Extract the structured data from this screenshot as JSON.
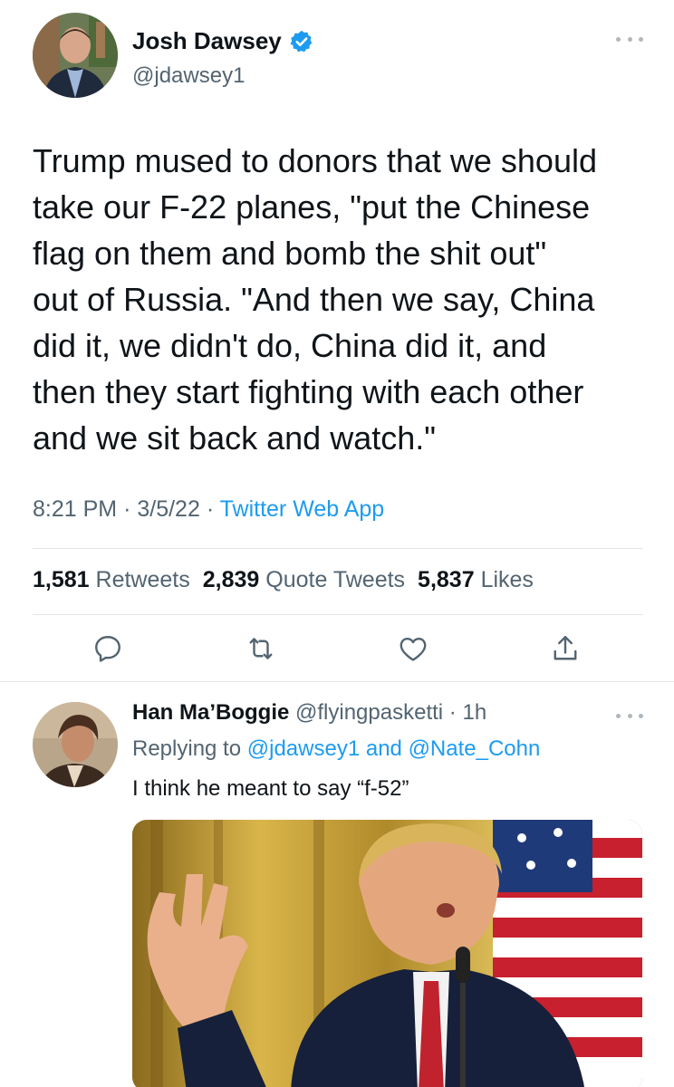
{
  "tweet": {
    "author_name": "Josh Dawsey",
    "author_handle": "@jdawsey1",
    "text": "Trump mused to donors that we should\ntake our F-22 planes, \"put the Chinese\nflag on them and bomb the shit out\"\nout of Russia. \"And then we say, China\ndid it, we didn't do, China did it, and\nthen they start fighting with each other\nand we sit back and watch.\"",
    "time": "8:21 PM",
    "date": "3/5/22",
    "source": "Twitter Web App",
    "retweets_count": "1,581",
    "retweets_label": "Retweets",
    "quotes_count": "2,839",
    "quotes_label": "Quote Tweets",
    "likes_count": "5,837",
    "likes_label": "Likes"
  },
  "reply": {
    "author_name": "Han Ma’Boggie",
    "author_handle": "@flyingpasketti",
    "time": "1h",
    "replying_prefix": "Replying to",
    "mention_1": "@jdawsey1",
    "conjunction": "and",
    "mention_2": "@Nate_Cohn",
    "text": "I think he meant to say “f-52”"
  },
  "icons": {
    "verified": "verified-badge-icon",
    "more": "more-options-icon",
    "reply": "reply-icon",
    "retweet": "retweet-icon",
    "like": "heart-icon",
    "share": "share-icon"
  },
  "colors": {
    "accent": "#1d9bf0",
    "text": "#0f1419",
    "secondary": "#536471",
    "divider": "#e1e6ea"
  }
}
